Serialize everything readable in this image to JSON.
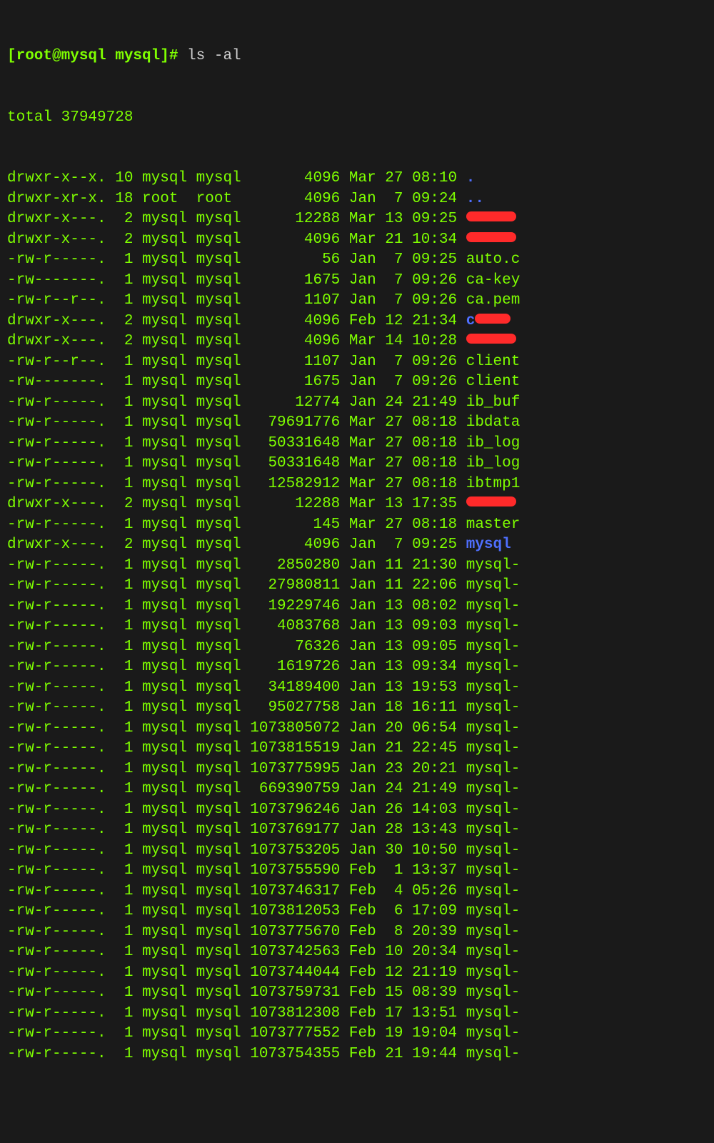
{
  "prompt": "[root@mysql mysql]# ",
  "command": "ls -al",
  "total_line": "total 37949728",
  "rows": [
    {
      "perm": "drwxr-x--x.",
      "links": "10",
      "owner": "mysql",
      "group": "mysql",
      "size": "4096",
      "month": "Mar",
      "day": "27",
      "time": "08:10",
      "name": ".",
      "cls": "blue",
      "redact": false
    },
    {
      "perm": "drwxr-xr-x.",
      "links": "18",
      "owner": "root ",
      "group": "root ",
      "size": "4096",
      "month": "Jan",
      "day": " 7",
      "time": "09:24",
      "name": "..",
      "cls": "blue",
      "redact": false
    },
    {
      "perm": "drwxr-x---.",
      "links": " 2",
      "owner": "mysql",
      "group": "mysql",
      "size": "12288",
      "month": "Mar",
      "day": "13",
      "time": "09:25",
      "name": "",
      "cls": "blue",
      "redact": true
    },
    {
      "perm": "drwxr-x---.",
      "links": " 2",
      "owner": "mysql",
      "group": "mysql",
      "size": "4096",
      "month": "Mar",
      "day": "21",
      "time": "10:34",
      "name": "",
      "cls": "blue",
      "redact": true
    },
    {
      "perm": "-rw-r-----.",
      "links": " 1",
      "owner": "mysql",
      "group": "mysql",
      "size": "56",
      "month": "Jan",
      "day": " 7",
      "time": "09:25",
      "name": "auto.c",
      "cls": "g",
      "redact": false
    },
    {
      "perm": "-rw-------.",
      "links": " 1",
      "owner": "mysql",
      "group": "mysql",
      "size": "1675",
      "month": "Jan",
      "day": " 7",
      "time": "09:26",
      "name": "ca-key",
      "cls": "g",
      "redact": false
    },
    {
      "perm": "-rw-r--r--.",
      "links": " 1",
      "owner": "mysql",
      "group": "mysql",
      "size": "1107",
      "month": "Jan",
      "day": " 7",
      "time": "09:26",
      "name": "ca.pem",
      "cls": "g",
      "redact": false
    },
    {
      "perm": "drwxr-x---.",
      "links": " 2",
      "owner": "mysql",
      "group": "mysql",
      "size": "4096",
      "month": "Feb",
      "day": "12",
      "time": "21:34",
      "name": "c",
      "cls": "blue",
      "redact": true
    },
    {
      "perm": "drwxr-x---.",
      "links": " 2",
      "owner": "mysql",
      "group": "mysql",
      "size": "4096",
      "month": "Mar",
      "day": "14",
      "time": "10:28",
      "name": "",
      "cls": "blue",
      "redact": true
    },
    {
      "perm": "-rw-r--r--.",
      "links": " 1",
      "owner": "mysql",
      "group": "mysql",
      "size": "1107",
      "month": "Jan",
      "day": " 7",
      "time": "09:26",
      "name": "client",
      "cls": "g",
      "redact": false
    },
    {
      "perm": "-rw-------.",
      "links": " 1",
      "owner": "mysql",
      "group": "mysql",
      "size": "1675",
      "month": "Jan",
      "day": " 7",
      "time": "09:26",
      "name": "client",
      "cls": "g",
      "redact": false
    },
    {
      "perm": "-rw-r-----.",
      "links": " 1",
      "owner": "mysql",
      "group": "mysql",
      "size": "12774",
      "month": "Jan",
      "day": "24",
      "time": "21:49",
      "name": "ib_buf",
      "cls": "g",
      "redact": false
    },
    {
      "perm": "-rw-r-----.",
      "links": " 1",
      "owner": "mysql",
      "group": "mysql",
      "size": "79691776",
      "month": "Mar",
      "day": "27",
      "time": "08:18",
      "name": "ibdata",
      "cls": "g",
      "redact": false
    },
    {
      "perm": "-rw-r-----.",
      "links": " 1",
      "owner": "mysql",
      "group": "mysql",
      "size": "50331648",
      "month": "Mar",
      "day": "27",
      "time": "08:18",
      "name": "ib_log",
      "cls": "g",
      "redact": false
    },
    {
      "perm": "-rw-r-----.",
      "links": " 1",
      "owner": "mysql",
      "group": "mysql",
      "size": "50331648",
      "month": "Mar",
      "day": "27",
      "time": "08:18",
      "name": "ib_log",
      "cls": "g",
      "redact": false
    },
    {
      "perm": "-rw-r-----.",
      "links": " 1",
      "owner": "mysql",
      "group": "mysql",
      "size": "12582912",
      "month": "Mar",
      "day": "27",
      "time": "08:18",
      "name": "ibtmp1",
      "cls": "g",
      "redact": false
    },
    {
      "perm": "drwxr-x---.",
      "links": " 2",
      "owner": "mysql",
      "group": "mysql",
      "size": "12288",
      "month": "Mar",
      "day": "13",
      "time": "17:35",
      "name": "",
      "cls": "blue",
      "redact": true
    },
    {
      "perm": "-rw-r-----.",
      "links": " 1",
      "owner": "mysql",
      "group": "mysql",
      "size": "145",
      "month": "Mar",
      "day": "27",
      "time": "08:18",
      "name": "master",
      "cls": "g",
      "redact": false
    },
    {
      "perm": "drwxr-x---.",
      "links": " 2",
      "owner": "mysql",
      "group": "mysql",
      "size": "4096",
      "month": "Jan",
      "day": " 7",
      "time": "09:25",
      "name": "mysql",
      "cls": "blue",
      "redact": false
    },
    {
      "perm": "-rw-r-----.",
      "links": " 1",
      "owner": "mysql",
      "group": "mysql",
      "size": "2850280",
      "month": "Jan",
      "day": "11",
      "time": "21:30",
      "name": "mysql-",
      "cls": "g",
      "redact": false
    },
    {
      "perm": "-rw-r-----.",
      "links": " 1",
      "owner": "mysql",
      "group": "mysql",
      "size": "27980811",
      "month": "Jan",
      "day": "11",
      "time": "22:06",
      "name": "mysql-",
      "cls": "g",
      "redact": false
    },
    {
      "perm": "-rw-r-----.",
      "links": " 1",
      "owner": "mysql",
      "group": "mysql",
      "size": "19229746",
      "month": "Jan",
      "day": "13",
      "time": "08:02",
      "name": "mysql-",
      "cls": "g",
      "redact": false
    },
    {
      "perm": "-rw-r-----.",
      "links": " 1",
      "owner": "mysql",
      "group": "mysql",
      "size": "4083768",
      "month": "Jan",
      "day": "13",
      "time": "09:03",
      "name": "mysql-",
      "cls": "g",
      "redact": false
    },
    {
      "perm": "-rw-r-----.",
      "links": " 1",
      "owner": "mysql",
      "group": "mysql",
      "size": "76326",
      "month": "Jan",
      "day": "13",
      "time": "09:05",
      "name": "mysql-",
      "cls": "g",
      "redact": false
    },
    {
      "perm": "-rw-r-----.",
      "links": " 1",
      "owner": "mysql",
      "group": "mysql",
      "size": "1619726",
      "month": "Jan",
      "day": "13",
      "time": "09:34",
      "name": "mysql-",
      "cls": "g",
      "redact": false
    },
    {
      "perm": "-rw-r-----.",
      "links": " 1",
      "owner": "mysql",
      "group": "mysql",
      "size": "34189400",
      "month": "Jan",
      "day": "13",
      "time": "19:53",
      "name": "mysql-",
      "cls": "g",
      "redact": false
    },
    {
      "perm": "-rw-r-----.",
      "links": " 1",
      "owner": "mysql",
      "group": "mysql",
      "size": "95027758",
      "month": "Jan",
      "day": "18",
      "time": "16:11",
      "name": "mysql-",
      "cls": "g",
      "redact": false
    },
    {
      "perm": "-rw-r-----.",
      "links": " 1",
      "owner": "mysql",
      "group": "mysql",
      "size": "1073805072",
      "month": "Jan",
      "day": "20",
      "time": "06:54",
      "name": "mysql-",
      "cls": "g",
      "redact": false
    },
    {
      "perm": "-rw-r-----.",
      "links": " 1",
      "owner": "mysql",
      "group": "mysql",
      "size": "1073815519",
      "month": "Jan",
      "day": "21",
      "time": "22:45",
      "name": "mysql-",
      "cls": "g",
      "redact": false
    },
    {
      "perm": "-rw-r-----.",
      "links": " 1",
      "owner": "mysql",
      "group": "mysql",
      "size": "1073775995",
      "month": "Jan",
      "day": "23",
      "time": "20:21",
      "name": "mysql-",
      "cls": "g",
      "redact": false
    },
    {
      "perm": "-rw-r-----.",
      "links": " 1",
      "owner": "mysql",
      "group": "mysql",
      "size": "669390759",
      "month": "Jan",
      "day": "24",
      "time": "21:49",
      "name": "mysql-",
      "cls": "g",
      "redact": false
    },
    {
      "perm": "-rw-r-----.",
      "links": " 1",
      "owner": "mysql",
      "group": "mysql",
      "size": "1073796246",
      "month": "Jan",
      "day": "26",
      "time": "14:03",
      "name": "mysql-",
      "cls": "g",
      "redact": false
    },
    {
      "perm": "-rw-r-----.",
      "links": " 1",
      "owner": "mysql",
      "group": "mysql",
      "size": "1073769177",
      "month": "Jan",
      "day": "28",
      "time": "13:43",
      "name": "mysql-",
      "cls": "g",
      "redact": false
    },
    {
      "perm": "-rw-r-----.",
      "links": " 1",
      "owner": "mysql",
      "group": "mysql",
      "size": "1073753205",
      "month": "Jan",
      "day": "30",
      "time": "10:50",
      "name": "mysql-",
      "cls": "g",
      "redact": false
    },
    {
      "perm": "-rw-r-----.",
      "links": " 1",
      "owner": "mysql",
      "group": "mysql",
      "size": "1073755590",
      "month": "Feb",
      "day": " 1",
      "time": "13:37",
      "name": "mysql-",
      "cls": "g",
      "redact": false
    },
    {
      "perm": "-rw-r-----.",
      "links": " 1",
      "owner": "mysql",
      "group": "mysql",
      "size": "1073746317",
      "month": "Feb",
      "day": " 4",
      "time": "05:26",
      "name": "mysql-",
      "cls": "g",
      "redact": false
    },
    {
      "perm": "-rw-r-----.",
      "links": " 1",
      "owner": "mysql",
      "group": "mysql",
      "size": "1073812053",
      "month": "Feb",
      "day": " 6",
      "time": "17:09",
      "name": "mysql-",
      "cls": "g",
      "redact": false
    },
    {
      "perm": "-rw-r-----.",
      "links": " 1",
      "owner": "mysql",
      "group": "mysql",
      "size": "1073775670",
      "month": "Feb",
      "day": " 8",
      "time": "20:39",
      "name": "mysql-",
      "cls": "g",
      "redact": false
    },
    {
      "perm": "-rw-r-----.",
      "links": " 1",
      "owner": "mysql",
      "group": "mysql",
      "size": "1073742563",
      "month": "Feb",
      "day": "10",
      "time": "20:34",
      "name": "mysql-",
      "cls": "g",
      "redact": false
    },
    {
      "perm": "-rw-r-----.",
      "links": " 1",
      "owner": "mysql",
      "group": "mysql",
      "size": "1073744044",
      "month": "Feb",
      "day": "12",
      "time": "21:19",
      "name": "mysql-",
      "cls": "g",
      "redact": false
    },
    {
      "perm": "-rw-r-----.",
      "links": " 1",
      "owner": "mysql",
      "group": "mysql",
      "size": "1073759731",
      "month": "Feb",
      "day": "15",
      "time": "08:39",
      "name": "mysql-",
      "cls": "g",
      "redact": false
    },
    {
      "perm": "-rw-r-----.",
      "links": " 1",
      "owner": "mysql",
      "group": "mysql",
      "size": "1073812308",
      "month": "Feb",
      "day": "17",
      "time": "13:51",
      "name": "mysql-",
      "cls": "g",
      "redact": false
    },
    {
      "perm": "-rw-r-----.",
      "links": " 1",
      "owner": "mysql",
      "group": "mysql",
      "size": "1073777552",
      "month": "Feb",
      "day": "19",
      "time": "19:04",
      "name": "mysql-",
      "cls": "g",
      "redact": false
    },
    {
      "perm": "-rw-r-----.",
      "links": " 1",
      "owner": "mysql",
      "group": "mysql",
      "size": "1073754355",
      "month": "Feb",
      "day": "21",
      "time": "19:44",
      "name": "mysql-",
      "cls": "g",
      "redact": false
    }
  ]
}
